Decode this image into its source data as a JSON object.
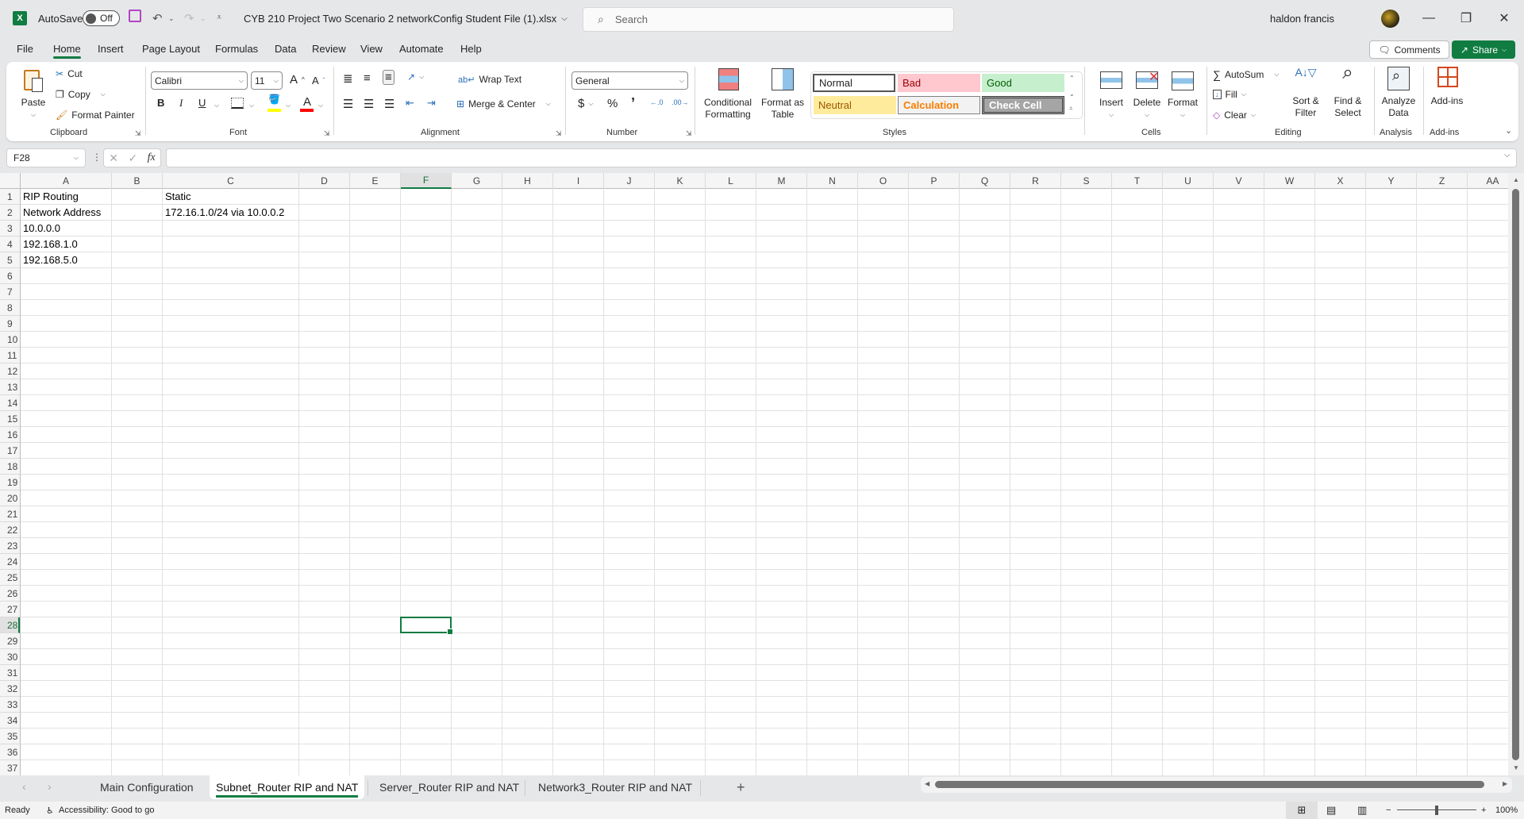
{
  "titlebar": {
    "app_icon": "excel-icon",
    "autosave_label": "AutoSave",
    "autosave_state": "Off",
    "file_title": "CYB 210 Project Two Scenario 2 networkConfig Student File (1).xlsx",
    "search_placeholder": "Search",
    "user_name": "haldon francis"
  },
  "menu": {
    "tabs": [
      "File",
      "Home",
      "Insert",
      "Page Layout",
      "Formulas",
      "Data",
      "Review",
      "View",
      "Automate",
      "Help"
    ],
    "active": "Home",
    "comments_label": "Comments",
    "share_label": "Share"
  },
  "ribbon": {
    "clipboard": {
      "label": "Clipboard",
      "paste": "Paste",
      "cut": "Cut",
      "copy": "Copy",
      "format_painter": "Format Painter"
    },
    "font": {
      "label": "Font",
      "font_name": "Calibri",
      "font_size": "11",
      "bold": "B",
      "italic": "I",
      "underline": "U",
      "highlight_color": "#ffff00",
      "font_color": "#ff0000"
    },
    "alignment": {
      "label": "Alignment",
      "wrap_text": "Wrap Text",
      "merge_center": "Merge & Center"
    },
    "number": {
      "label": "Number",
      "format": "General",
      "currency": "$",
      "percent": "%",
      "comma": "’"
    },
    "styles": {
      "label": "Styles",
      "conditional_formatting": "Conditional Formatting",
      "format_as_table": "Format as Table",
      "cells": [
        {
          "name": "Normal",
          "bg": "#ffffff",
          "fg": "#000000"
        },
        {
          "name": "Bad",
          "bg": "#ffc7ce",
          "fg": "#9c0006"
        },
        {
          "name": "Good",
          "bg": "#c6efce",
          "fg": "#006100"
        },
        {
          "name": "Neutral",
          "bg": "#ffeb9c",
          "fg": "#9c5700"
        },
        {
          "name": "Calculation",
          "bg": "#f2f2f2",
          "fg": "#fa7d00"
        },
        {
          "name": "Check Cell",
          "bg": "#a5a5a5",
          "fg": "#ffffff"
        }
      ]
    },
    "cells": {
      "label": "Cells",
      "insert": "Insert",
      "delete": "Delete",
      "format": "Format"
    },
    "editing": {
      "label": "Editing",
      "autosum": "AutoSum",
      "fill": "Fill",
      "clear": "Clear",
      "sort_filter": "Sort & Filter",
      "find_select": "Find & Select"
    },
    "analysis": {
      "label": "Analysis",
      "analyze_data": "Analyze Data"
    },
    "addins": {
      "label": "Add-ins",
      "addins_btn": "Add-ins"
    }
  },
  "formula_bar": {
    "name_box": "F28",
    "formula": ""
  },
  "sheet": {
    "columns": [
      "A",
      "B",
      "C",
      "D",
      "E",
      "F",
      "G",
      "H",
      "I",
      "J",
      "K",
      "L",
      "M",
      "N",
      "O",
      "P",
      "Q",
      "R",
      "S",
      "T",
      "U",
      "V",
      "W",
      "X",
      "Y",
      "Z",
      "AA"
    ],
    "selected_column": "F",
    "selected_row": 28,
    "row_count": 37,
    "cells": {
      "A1": "RIP Routing",
      "C1": "Static",
      "A2": "Network Address",
      "C2": "172.16.1.0/24 via 10.0.0.2",
      "A3": "10.0.0.0",
      "A4": "192.168.1.0",
      "A5": "192.168.5.0"
    }
  },
  "sheet_tabs": {
    "tabs": [
      "Main Configuration",
      "Subnet_Router RIP and NAT",
      "Server_Router RIP and NAT",
      "Network3_Router RIP and NAT"
    ],
    "active": "Subnet_Router RIP and NAT",
    "add_label": "+"
  },
  "status": {
    "ready": "Ready",
    "accessibility": "Accessibility: Good to go",
    "zoom": "100%",
    "zoom_value": 100
  },
  "colors": {
    "accent": "#107c41"
  }
}
